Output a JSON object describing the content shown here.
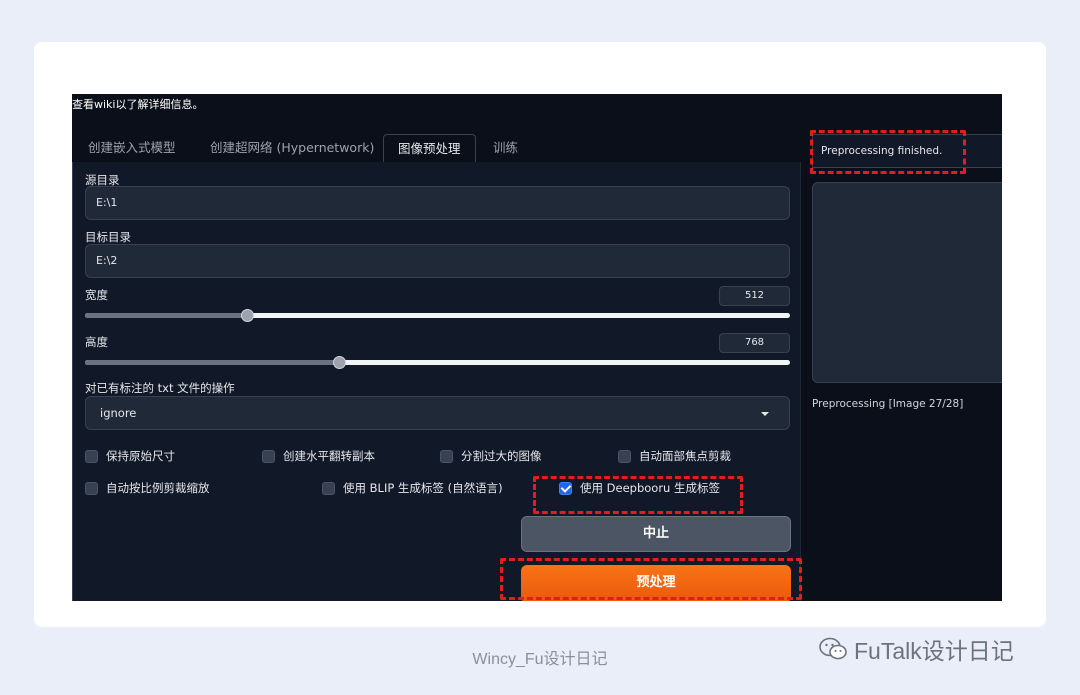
{
  "screenshot": {
    "wiki_hint": "查看wiki以了解详细信息。",
    "tabs": [
      {
        "label": "创建嵌入式模型"
      },
      {
        "label": "创建超网络 (Hypernetwork)"
      },
      {
        "label": "图像预处理"
      },
      {
        "label": "训练"
      }
    ],
    "active_tab": "图像预处理",
    "source_dir": {
      "label": "源目录",
      "value": "E:\\1"
    },
    "target_dir": {
      "label": "目标目录",
      "value": "E:\\2"
    },
    "width": {
      "label": "宽度",
      "value": "512",
      "fraction": 0.23
    },
    "height": {
      "label": "高度",
      "value": "768",
      "fraction": 0.36
    },
    "existing_caption_action": {
      "label": "对已有标注的 txt 文件的操作",
      "selected": "ignore"
    },
    "checkboxes": [
      {
        "label": "保持原始尺寸",
        "checked": false
      },
      {
        "label": "创建水平翻转副本",
        "checked": false
      },
      {
        "label": "分割过大的图像",
        "checked": false
      },
      {
        "label": "自动面部焦点剪裁",
        "checked": false
      },
      {
        "label": "自动按比例剪裁缩放",
        "checked": false
      },
      {
        "label": "使用 BLIP 生成标签 (自然语言)",
        "checked": false
      },
      {
        "label": "使用 Deepbooru 生成标签",
        "checked": true
      }
    ],
    "buttons": {
      "stop": "中止",
      "preprocess": "预处理"
    },
    "status_text": "Preprocessing finished.",
    "progress_text": "Preprocessing [Image 27/28]"
  },
  "caption": "Wincy_Fu设计日记",
  "watermark": "FuTalk设计日记",
  "colors": {
    "accent_orange": "#f97316",
    "highlight_red": "#e11d1d",
    "checkbox_blue": "#2563eb"
  }
}
